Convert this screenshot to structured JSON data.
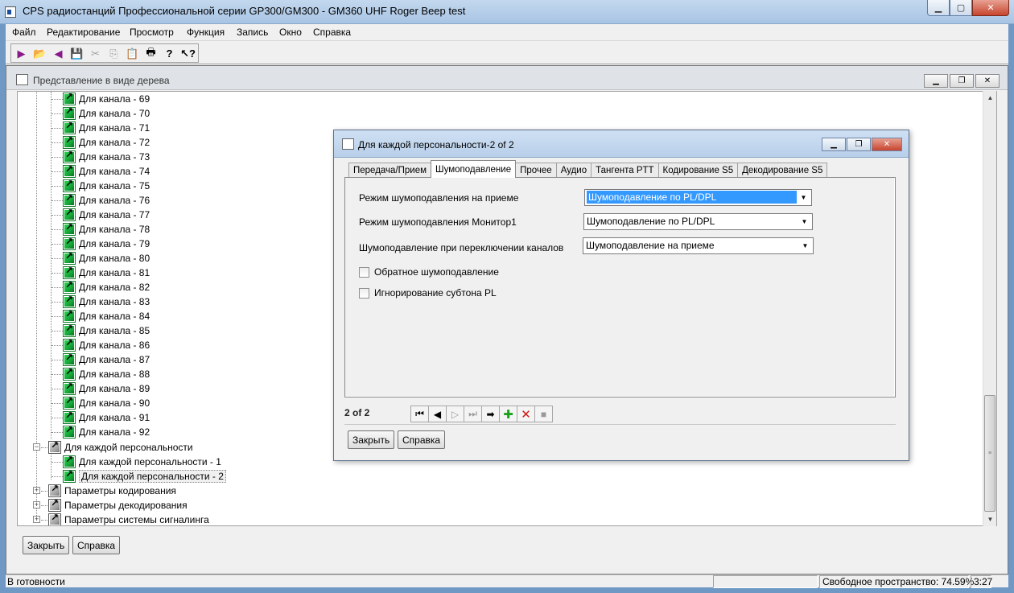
{
  "window": {
    "title": "CPS радиостанций Профессиональной серии GP300/GM300 - GM360 UHF Roger Beep test"
  },
  "menu": [
    "Файл",
    "Редактирование",
    "Просмотр",
    "Функция",
    "Запись",
    "Окно",
    "Справка"
  ],
  "tree_window": {
    "title": "Представление в виде дерева",
    "close_label": "Закрыть",
    "help_label": "Справка",
    "channels": [
      "Для канала - 69",
      "Для канала - 70",
      "Для канала - 71",
      "Для канала - 72",
      "Для канала - 73",
      "Для канала - 74",
      "Для канала - 75",
      "Для канала - 76",
      "Для канала - 77",
      "Для канала - 78",
      "Для канала - 79",
      "Для канала - 80",
      "Для канала - 81",
      "Для канала - 82",
      "Для канала - 83",
      "Для канала - 84",
      "Для канала - 85",
      "Для канала - 86",
      "Для канала - 87",
      "Для канала - 88",
      "Для канала - 89",
      "Для канала - 90",
      "Для канала - 91",
      "Для канала - 92"
    ],
    "personality_group": "Для каждой персональности",
    "personalities": [
      "Для каждой персональности - 1",
      "Для каждой персональности - 2"
    ],
    "other_groups": [
      "Параметры кодирования",
      "Параметры  декодирования",
      "Параметры системы сигналинга"
    ]
  },
  "dialog": {
    "title": "Для каждой персональности-2 of 2",
    "tabs": [
      "Передача/Прием",
      "Шумоподавление",
      "Прочее",
      "Аудио",
      "Тангента PTT",
      "Кодирование S5",
      "Декодирование S5"
    ],
    "active_tab": 1,
    "fields": [
      {
        "label": "Режим шумоподавления на приеме",
        "value": "Шумоподавление по PL/DPL"
      },
      {
        "label": "Режим шумоподавления Монитор1",
        "value": "Шумоподавление по PL/DPL"
      },
      {
        "label": "Шумоподавление при переключении каналов",
        "value": "Шумоподавление на приеме"
      }
    ],
    "checkboxes": [
      {
        "label": "Обратное шумоподавление",
        "checked": false
      },
      {
        "label": "Игнорирование субтона PL",
        "checked": false
      }
    ],
    "record_counter": "2 of 2",
    "close_label": "Закрыть",
    "help_label": "Справка"
  },
  "status": {
    "ready": "В готовности",
    "free_space": "Свободное пространство: 74.59%",
    "time": "3:27"
  }
}
